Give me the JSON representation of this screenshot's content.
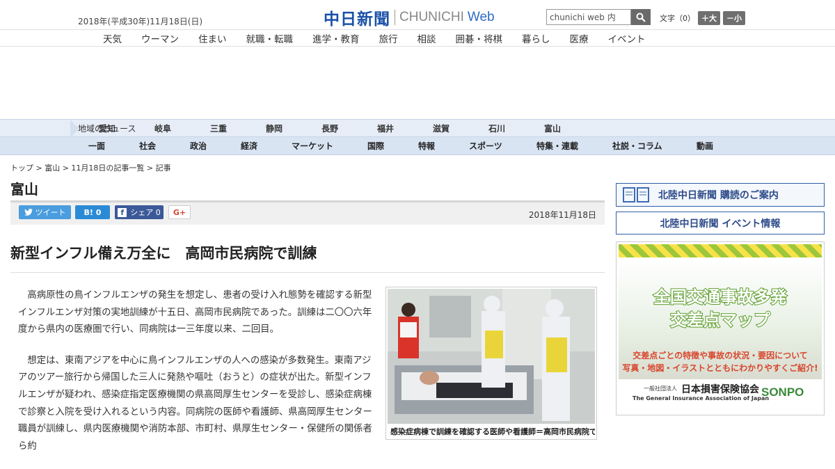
{
  "header": {
    "date": "2018年(平成30年)11月18日(日)",
    "logo_ja": "中日新聞",
    "logo_en": "CHUNICHI",
    "logo_web": "Web",
    "search_value": "chunichi web 内",
    "font_label": "文字（0）",
    "font_bigger": "＋大",
    "font_smaller": "－小"
  },
  "nav": [
    "天気",
    "ウーマン",
    "住まい",
    "就職・転職",
    "進学・教育",
    "旅行",
    "相談",
    "囲碁・将棋",
    "暮らし",
    "医療",
    "イベント"
  ],
  "region": {
    "label": "地域のニュース",
    "items": [
      "愛知",
      "岐阜",
      "三重",
      "静岡",
      "長野",
      "福井",
      "滋賀",
      "石川",
      "富山"
    ]
  },
  "categories": [
    "一面",
    "社会",
    "政治",
    "経済",
    "マーケット",
    "国際",
    "特報",
    "スポーツ",
    "特集・連載",
    "社説・コラム",
    "動画"
  ],
  "breadcrumb": "トップ > 富山 > 11月18日の記事一覧 > 記事",
  "page_title": "富山",
  "share": {
    "tweet": "ツイート",
    "hatena": "B! 0",
    "facebook": "シェア 0",
    "gplus": "G+"
  },
  "article": {
    "date": "2018年11月18日",
    "headline": "新型インフル備え万全に　高岡市民病院で訓練",
    "paragraphs": [
      "高病原性の鳥インフルエンザの発生を想定し、患者の受け入れ態勢を確認する新型インフルエンザ対策の実地訓練が十五日、高岡市民病院であった。訓練は二〇〇六年度から県内の医療圏で行い、同病院は一三年度以来、二回目。",
      "想定は、東南アジアを中心に鳥インフルエンザの人への感染が多数発生。東南アジアのツアー旅行から帰国した三人に発熱や嘔吐（おうと）の症状が出た。新型インフルエンザが疑われ、感染症指定医療機関の県高岡厚生センターを受診し、感染症病棟で診察と入院を受け入れるという内容。同病院の医師や看護師、県高岡厚生センター職員が訓練し、県内医療機関や消防本部、市町村、県厚生センター・保健所の関係者ら約"
    ],
    "photo_caption": "感染症病棟で訓練を確認する医師や看護師＝高岡市民病院で"
  },
  "sidebar": {
    "subscribe": "北陸中日新聞 購読のご案内",
    "events": "北陸中日新聞 イベント情報",
    "banner_line1": "全国交通事故多発",
    "banner_line2": "交差点マップ",
    "banner_line3": "交差点ごとの特徴や事故の状況・要因について",
    "banner_line4": "写真・地図・イラストとともにわかりやすくご紹介!",
    "org_small": "一般社団法人",
    "org_ja": "日本損害保険協会",
    "org_en": "The General Insurance Association of Japan",
    "org_brand": "SONPO"
  }
}
